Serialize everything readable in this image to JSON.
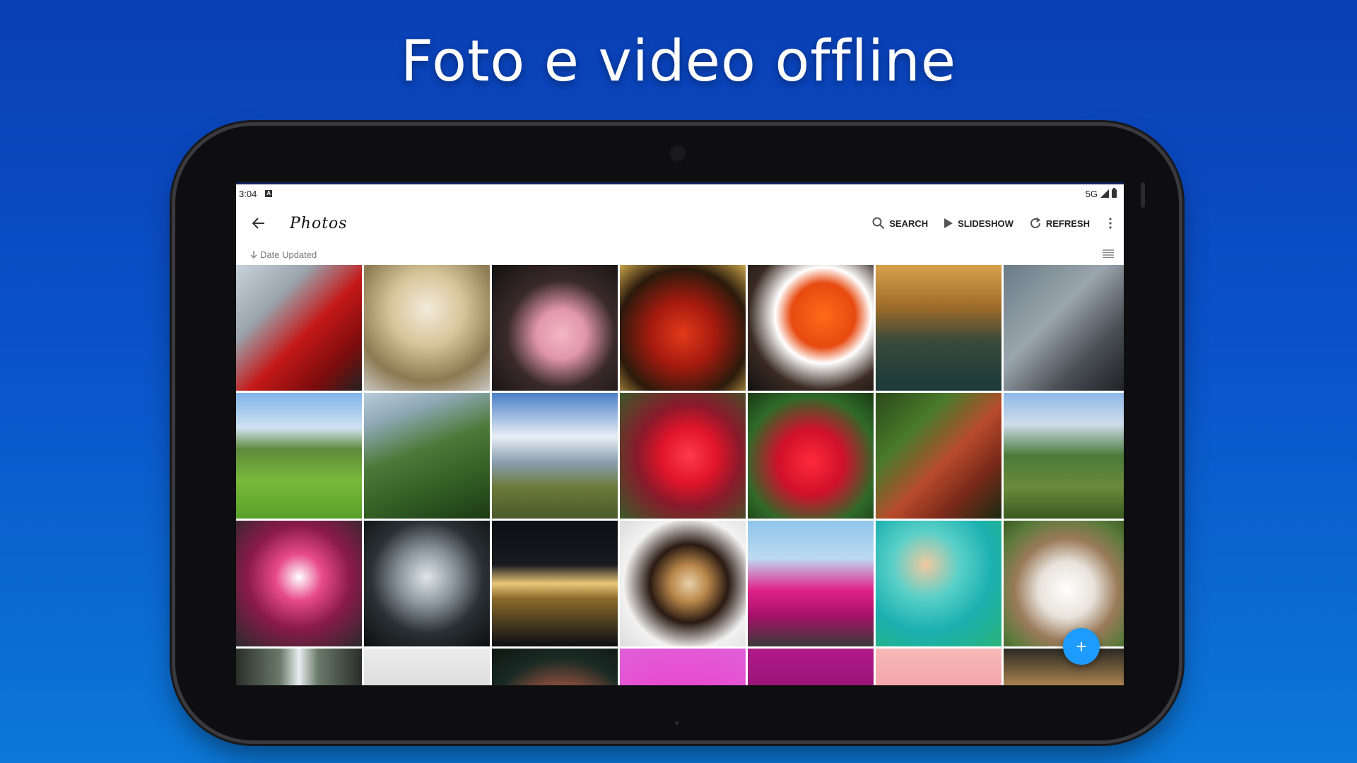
{
  "headline": "Foto e video offline",
  "status_bar": {
    "time": "3:04",
    "network": "5G"
  },
  "app_bar": {
    "title": "Photos",
    "actions": [
      {
        "label": "SEARCH",
        "icon": "search-icon"
      },
      {
        "label": "SLIDESHOW",
        "icon": "play-icon"
      },
      {
        "label": "REFRESH",
        "icon": "refresh-icon"
      }
    ]
  },
  "sort": {
    "label": "Date Updated",
    "direction_icon": "arrow-down-icon"
  },
  "colors": {
    "accent": "#1e9bff",
    "background_top": "#0a3fb5",
    "background_bottom": "#0b78d8"
  },
  "photos": [
    {
      "name": "red-sports-car",
      "bg": "linear-gradient(135deg,#c9d3dc 0%,#9aa3ac 30%,#c41818 55%,#7a0c0c 80%,#222 100%)"
    },
    {
      "name": "venetian-mask-gold",
      "bg": "radial-gradient(circle at 50% 35%,#f3eadb 0%,#d8c59a 35%,#8d7a52 70%,#c9c6c0 100%)"
    },
    {
      "name": "pink-flamingo",
      "bg": "radial-gradient(circle at 55% 55%,#f1b6c4 0%,#e296ab 25%,#3a2a2a 55%,#121010 100%)"
    },
    {
      "name": "red-carnival-costume",
      "bg": "radial-gradient(circle at 50% 55%,#e23a1a 0%,#a51a0e 35%,#2b1a0c 70%,#c9a44a 100%)"
    },
    {
      "name": "orange-hat-mask",
      "bg": "radial-gradient(circle at 60% 40%,#ff6a1a 0%,#e84a10 30%,#ffffff 45%,#3a2a22 70%,#111 100%)"
    },
    {
      "name": "venice-canal",
      "bg": "linear-gradient(180deg,#d8a04a 0%,#9a6a2a 35%,#3a4a3a 60%,#1a3a3a 100%)"
    },
    {
      "name": "woman-pigeons",
      "bg": "linear-gradient(135deg,#6a7b86 0%,#9aa6ad 40%,#4a4f55 70%,#1c1f22 100%)"
    },
    {
      "name": "cable-car-meadow",
      "bg": "linear-gradient(180deg,#7fb3e8 0%,#cfe2f2 28%,#5e8a3a 45%,#79b93a 70%,#5aa02a 100%)"
    },
    {
      "name": "green-mountain-ridge",
      "bg": "linear-gradient(160deg,#b8cbd8 0%,#8ea8b5 20%,#4d7a3a 45%,#2f5a22 75%,#1c3a14 100%)"
    },
    {
      "name": "snowy-alps-hikers",
      "bg": "linear-gradient(180deg,#4a7fc8 0%,#e8eef4 35%,#8aa0b2 55%,#6b7a3a 75%,#4a5a2a 100%)"
    },
    {
      "name": "red-tulip-drops",
      "bg": "radial-gradient(circle at 55% 50%,#ff3b4a 0%,#e0142a 30%,#8a1a2a 55%,#3a5a2a 100%)"
    },
    {
      "name": "red-tulips-field",
      "bg": "radial-gradient(circle at 50% 55%,#ff2a3a 0%,#d0102a 35%,#2f6a2a 70%,#1a3a14 100%)"
    },
    {
      "name": "red-pagoda",
      "bg": "linear-gradient(135deg,#2a4a1a 0%,#4a7a2a 30%,#b84a2a 55%,#7a2a1a 75%,#1a2a12 100%)"
    },
    {
      "name": "terraced-valley",
      "bg": "linear-gradient(180deg,#8fb8e8 0%,#cfdcea 25%,#4a7a3a 50%,#6a8a3a 75%,#3a5a22 100%)"
    },
    {
      "name": "floral-dress-art",
      "bg": "radial-gradient(circle at 50% 45%,#ffffff 0%,#e84a8a 25%,#8a1a4a 55%,#2a2a2a 100%)"
    },
    {
      "name": "glass-dome-night",
      "bg": "radial-gradient(circle at 50% 45%,#dfe6ea 0%,#8a969c 30%,#2a3034 60%,#0c0e10 100%)"
    },
    {
      "name": "palace-night-reflection",
      "bg": "linear-gradient(180deg,#0c0e14 0%,#1a1a22 35%,#e8c878 50%,#8a6a2a 62%,#0c0e14 100%)"
    },
    {
      "name": "latte-croissant",
      "bg": "radial-gradient(circle at 55% 50%,#e8d0a8 0%,#b8864a 20%,#2a1a12 42%,#f2f2f2 70%,#dcdcdc 100%)"
    },
    {
      "name": "pink-cocktails",
      "bg": "linear-gradient(180deg,#8fc4ea 0%,#bcdaf0 30%,#e0248a 55%,#a8106a 75%,#3a3a3a 100%)"
    },
    {
      "name": "snorkel-diver",
      "bg": "radial-gradient(circle at 40% 35%,#f0c8a0 0%,#5ad0c8 30%,#1ab0b0 60%,#2ab47a 100%)"
    },
    {
      "name": "cow-closeup",
      "bg": "radial-gradient(circle at 50% 55%,#ffffff 0%,#e8e2da 30%,#9a7a5a 55%,#5a7a3a 80%,#3a5a22 100%)"
    },
    {
      "name": "waterfall",
      "bg": "linear-gradient(90deg,#2a2e2a 0%,#6a7a6a 35%,#e8eef0 50%,#6a7a6a 65%,#2a2e2a 100%)"
    },
    {
      "name": "black-stones",
      "bg": "linear-gradient(180deg,#ececec 0%,#d8d8d8 40%,#2a2a2a 60%,#e0e0e0 100%)"
    },
    {
      "name": "flamingo-water",
      "bg": "radial-gradient(circle at 55% 70%,#f08a6a 0%,#c8604a 30%,#1a2a24 70%,#0e1612 100%)"
    },
    {
      "name": "yellow-flower",
      "bg": "radial-gradient(circle at 50% 85%,#f2a81a 0%,#d88a10 25%,#e84ad0 55%,#e060d8 100%)"
    },
    {
      "name": "magenta-fronds",
      "bg": "linear-gradient(180deg,#b01a8a 0%,#8a106a 50%,#6a0c52 100%)"
    },
    {
      "name": "pink-coral",
      "bg": "linear-gradient(180deg,#f8b8b8 0%,#f09aa0 50%,#e88088 100%)"
    },
    {
      "name": "palm-sunset",
      "bg": "linear-gradient(180deg,#2a2a22 0%,#d8a060 40%,#f0b878 100%)"
    }
  ]
}
